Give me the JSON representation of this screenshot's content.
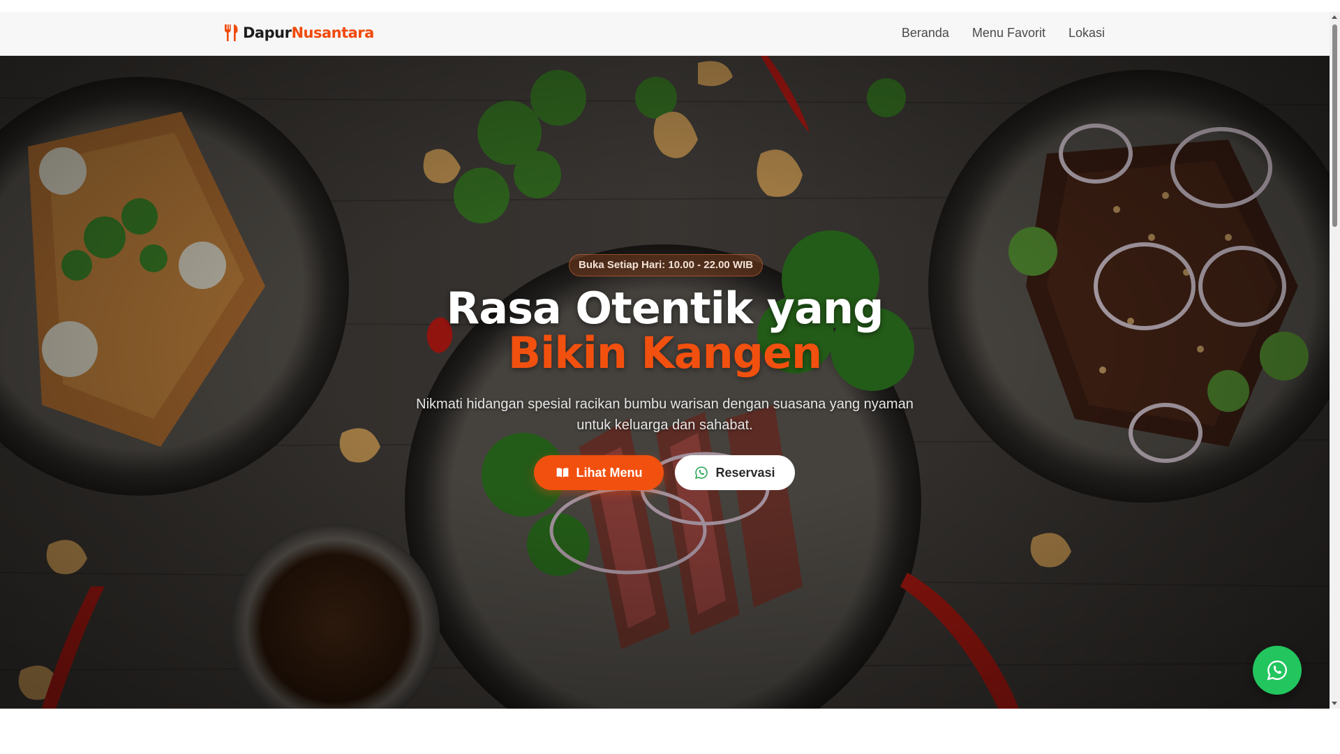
{
  "nav": {
    "brand_part1": "Dapur",
    "brand_part2": "Nusantara",
    "links": [
      "Beranda",
      "Menu Favorit",
      "Lokasi"
    ]
  },
  "hero": {
    "hours_badge": "Buka Setiap Hari: 10.00 - 22.00 WIB",
    "headline_line1": "Rasa Otentik yang",
    "headline_line2": "Bikin Kangen",
    "subtext": "Nikmati hidangan spesial racikan bumbu warisan dengan suasana yang nyaman untuk keluarga dan sahabat.",
    "btn_menu": "Lihat Menu",
    "btn_reserve": "Reservasi"
  },
  "icons": {
    "brand": "utensils-icon",
    "menu_button": "book-open-icon",
    "reserve_button": "whatsapp-icon",
    "floating": "whatsapp-icon"
  },
  "colors": {
    "accent": "#f2500f",
    "whatsapp": "#22c55e",
    "navbar_bg": "#f7f7f7"
  }
}
